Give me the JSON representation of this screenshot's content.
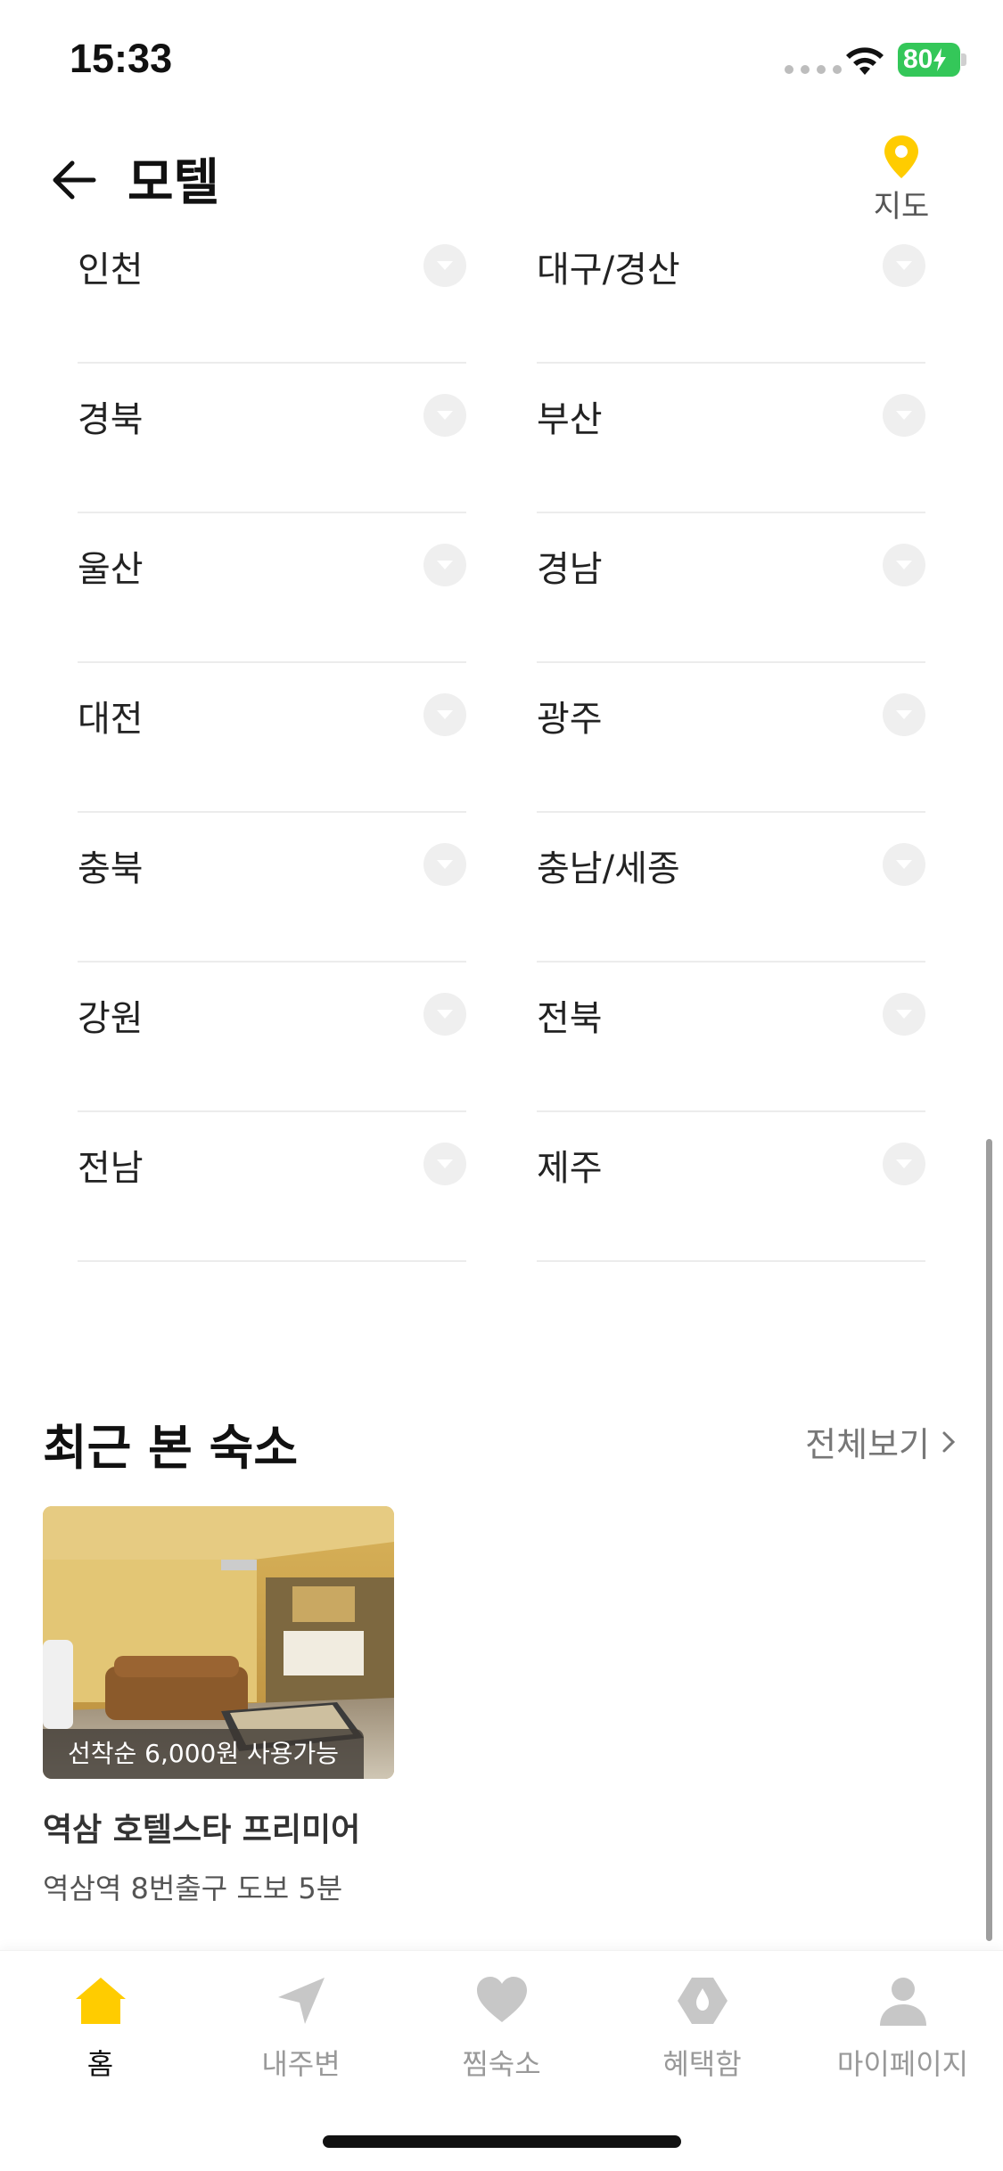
{
  "status_bar": {
    "time": "15:33",
    "battery": "80"
  },
  "header": {
    "title": "모텔",
    "map_label": "지도"
  },
  "regions": [
    [
      "인천",
      "대구/경산"
    ],
    [
      "경북",
      "부산"
    ],
    [
      "울산",
      "경남"
    ],
    [
      "대전",
      "광주"
    ],
    [
      "충북",
      "충남/세종"
    ],
    [
      "강원",
      "전북"
    ],
    [
      "전남",
      "제주"
    ]
  ],
  "recent": {
    "title": "최근 본 숙소",
    "view_all": "전체보기",
    "card": {
      "badge": "선착순 6,000원 사용가능",
      "name": "역삼 호텔스타 프리미어",
      "location": "역삼역 8번출구 도보 5분"
    }
  },
  "tabs": [
    {
      "label": "홈",
      "icon": "home-icon",
      "active": true
    },
    {
      "label": "내주변",
      "icon": "location-arrow-icon",
      "active": false
    },
    {
      "label": "찜숙소",
      "icon": "heart-icon",
      "active": false
    },
    {
      "label": "혜택함",
      "icon": "benefit-hexagon-icon",
      "active": false
    },
    {
      "label": "마이페이지",
      "icon": "profile-icon",
      "active": false
    }
  ],
  "colors": {
    "accent": "#ffcc00",
    "battery": "#34c759",
    "inactive": "#c7c7c7"
  }
}
